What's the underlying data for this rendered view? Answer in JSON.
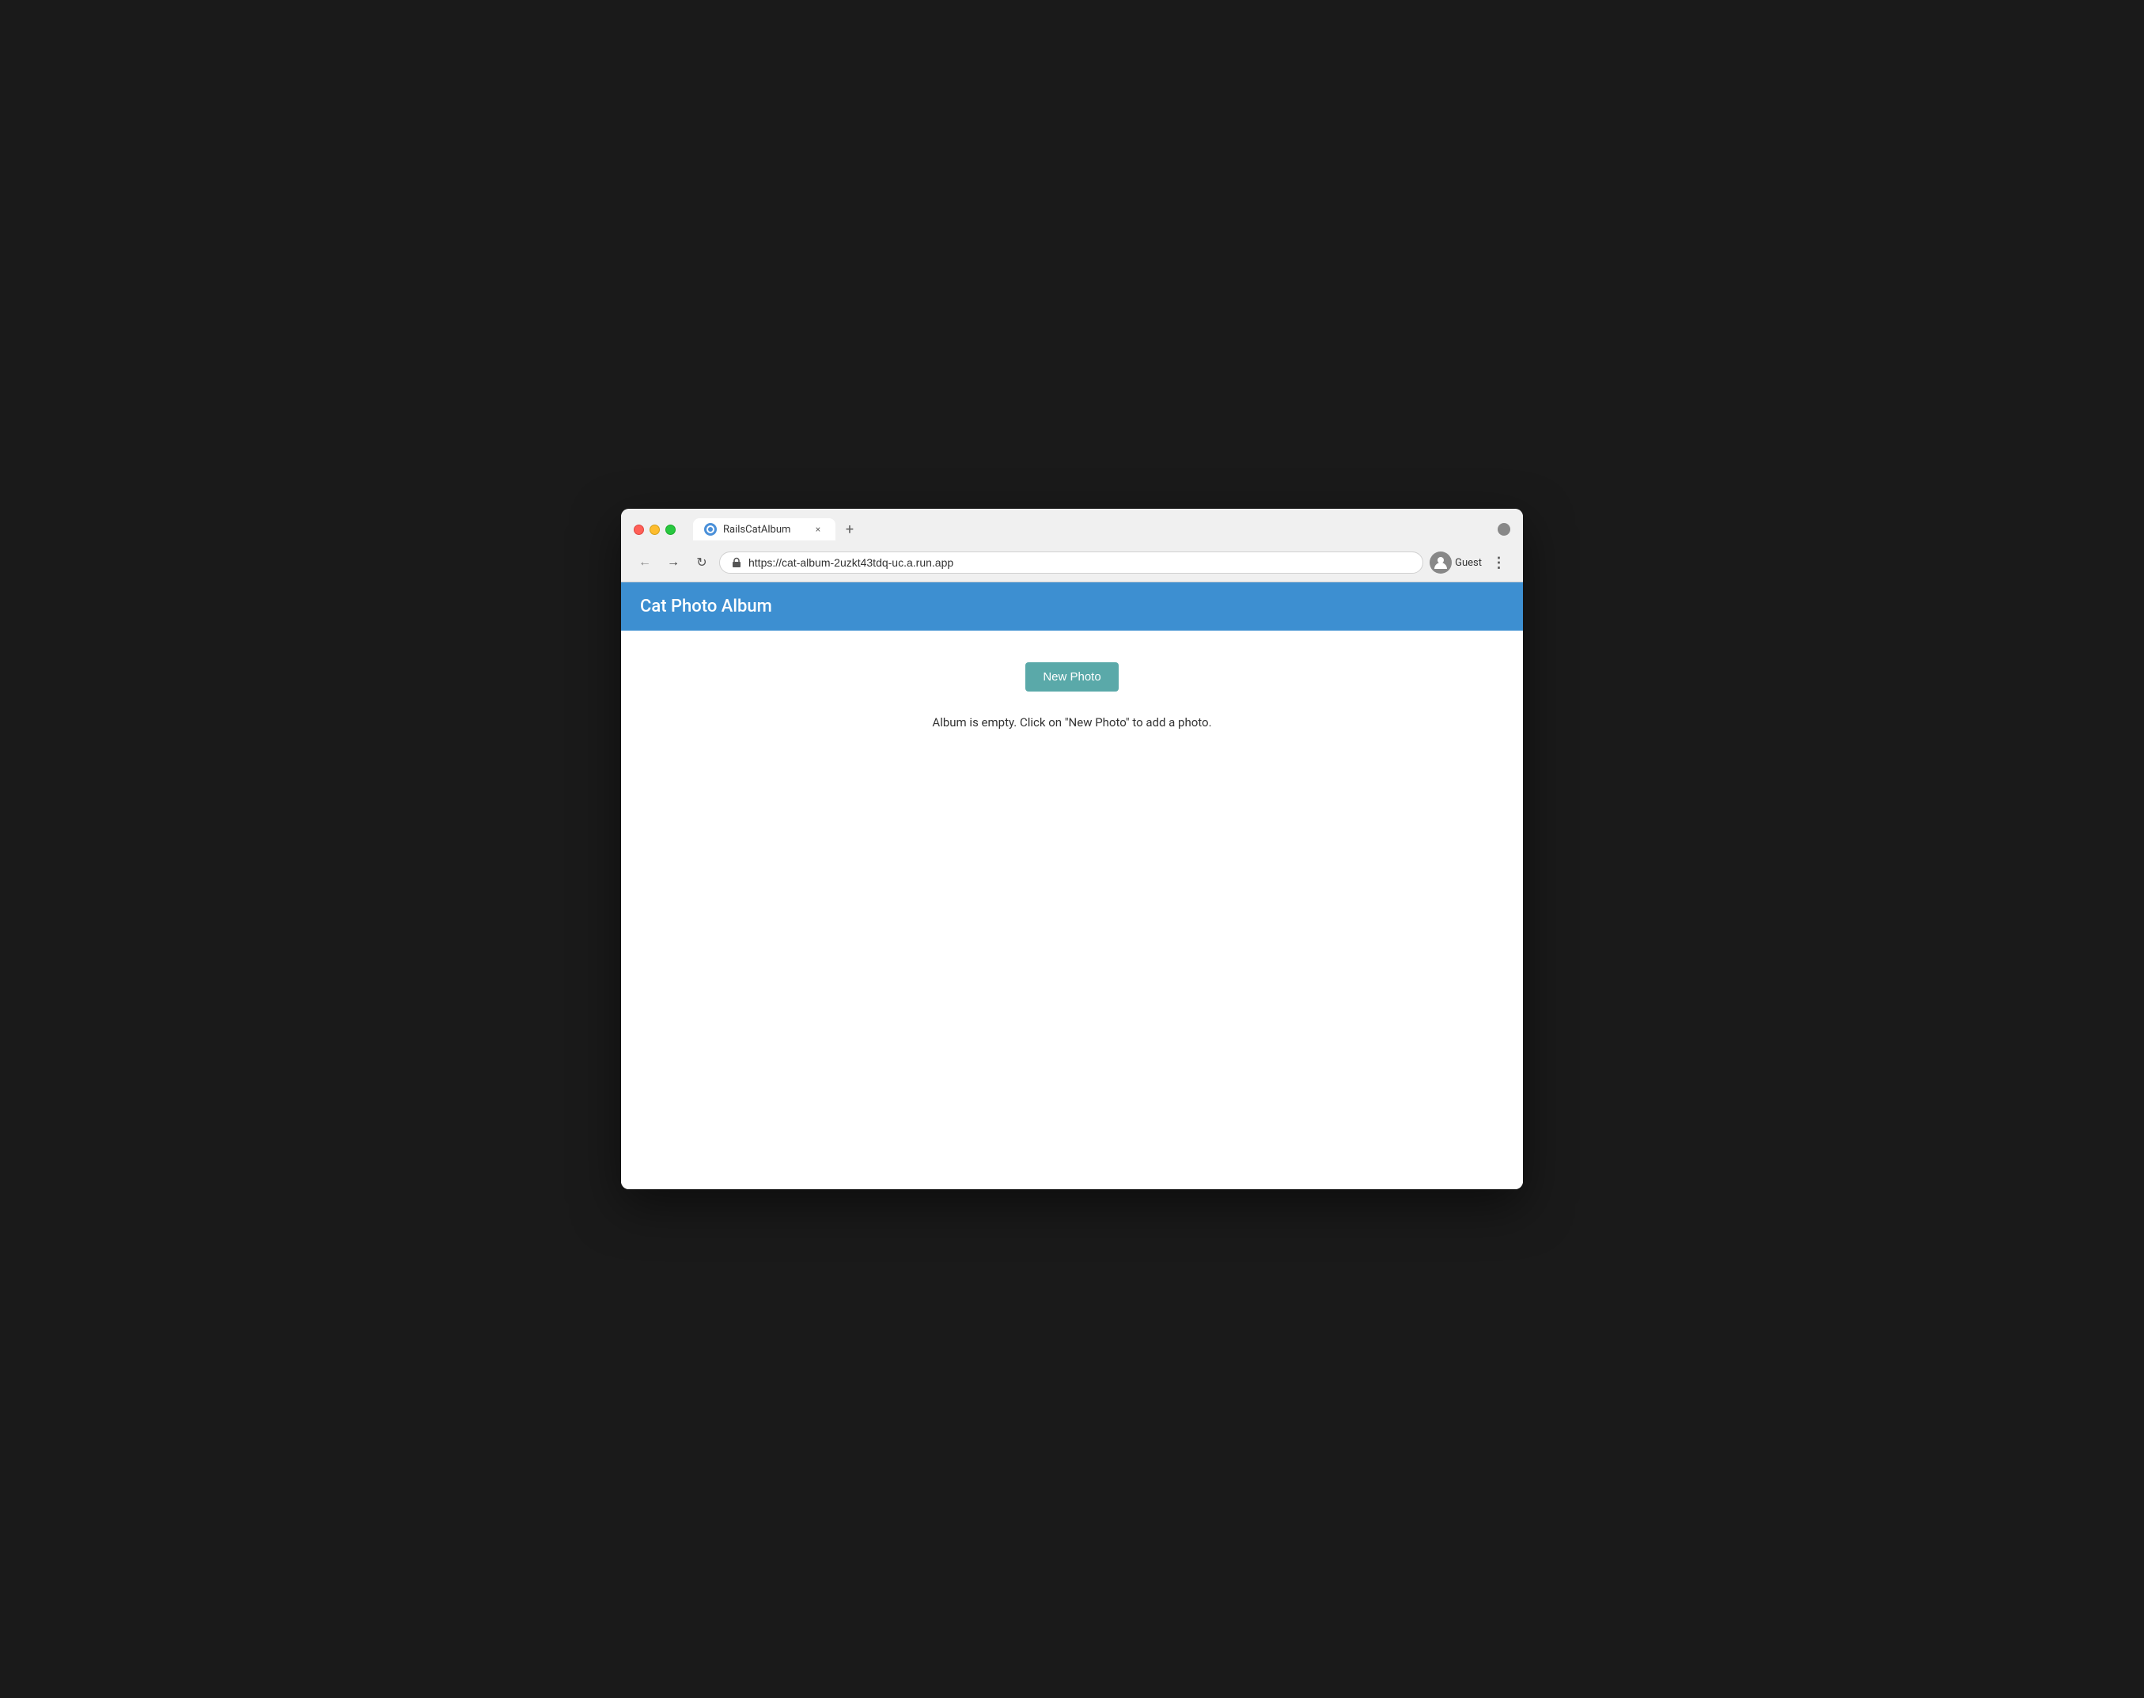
{
  "browser": {
    "title": "RailsCatAlbum",
    "url": "https://cat-album-2uzkt43tdq-uc.a.run.app",
    "tab_close_label": "×",
    "new_tab_label": "+",
    "back_label": "←",
    "forward_label": "→",
    "refresh_label": "↻",
    "profile_name": "Guest",
    "more_label": "⋮"
  },
  "app": {
    "header_title": "Cat Photo Album",
    "new_photo_button": "New Photo",
    "empty_message": "Album is empty. Click on \"New Photo\" to add a photo."
  },
  "colors": {
    "header_bg": "#3d8fd1",
    "new_photo_btn_bg": "#5aa9a9"
  }
}
